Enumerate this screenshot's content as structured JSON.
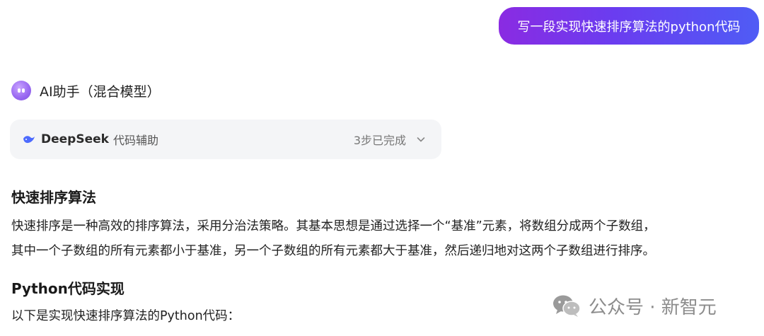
{
  "user_message": {
    "text": "写一段实现快速排序算法的python代码"
  },
  "assistant": {
    "name": "AI助手（混合模型）",
    "avatar_icon": "robot-avatar-icon"
  },
  "reasoning_panel": {
    "brand": "DeepSeek",
    "subtitle": "代码辅助",
    "status": "3步已完成",
    "icon": "whale-icon",
    "toggle_icon": "chevron-down-icon"
  },
  "content": {
    "heading_1": "快速排序算法",
    "para_1_line_1": "快速排序是一种高效的排序算法，采用分治法策略。其基本思想是通过选择一个“基准”元素，将数组分成两个子数组，",
    "para_1_line_2": "其中一个子数组的所有元素都小于基准，另一个子数组的所有元素都大于基准，然后递归地对这两个子数组进行排序。",
    "heading_2": "Python代码实现",
    "para_2": "以下是实现快速排序算法的Python代码："
  },
  "watermark": {
    "text": "公众号 · 新智元",
    "icon": "wechat-icon"
  },
  "colors": {
    "bubble_start": "#8a2be2",
    "bubble_end": "#4f5cf5",
    "panel_bg": "#f4f5f7",
    "deepseek_blue": "#4d6bfe"
  }
}
